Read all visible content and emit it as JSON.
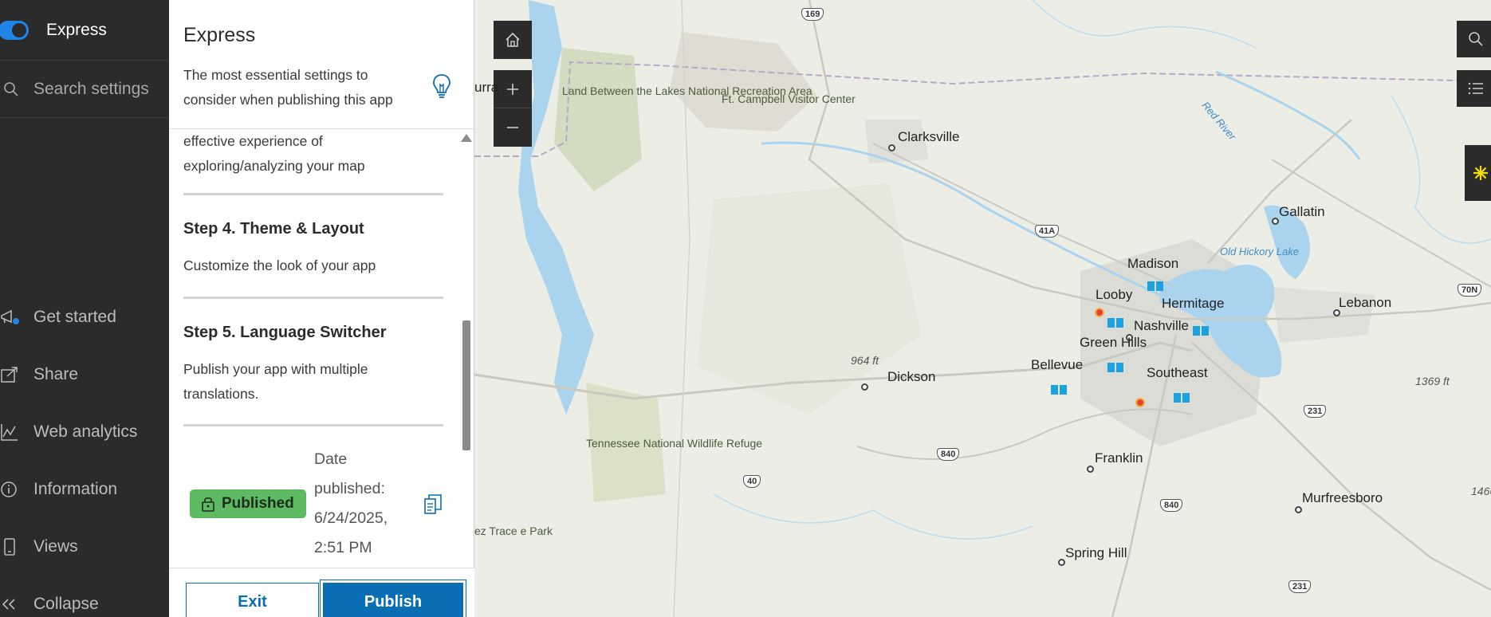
{
  "nav": {
    "mode_label": "Express",
    "search_placeholder": "Search settings",
    "items": [
      {
        "label": "Get started",
        "icon": "megaphone-icon"
      },
      {
        "label": "Share",
        "icon": "share-icon"
      },
      {
        "label": "Web analytics",
        "icon": "analytics-icon"
      },
      {
        "label": "Information",
        "icon": "information-icon"
      },
      {
        "label": "Views",
        "icon": "mobile-device-icon"
      },
      {
        "label": "Collapse",
        "icon": "double-chevron-left-icon"
      }
    ],
    "toggle_color": "#1f86e8"
  },
  "panel": {
    "title": "Express",
    "description": "The most essential settings to consider when publishing this app",
    "step3_tail": "effective experience of exploring/analyzing your map",
    "steps": [
      {
        "title": "Step 4. Theme & Layout",
        "desc": "Customize the look of your app"
      },
      {
        "title": "Step 5. Language Switcher",
        "desc": "Publish your app with multiple translations."
      }
    ],
    "status_badge": "Published",
    "date_published": "Date published: 6/24/2025, 2:51 PM",
    "exit_label": "Exit",
    "publish_label": "Publish"
  },
  "map": {
    "places": {
      "clarksville": "Clarksville",
      "gallatin": "Gallatin",
      "madison": "Madison",
      "looby": "Looby",
      "hermitage": "Hermitage",
      "nashville": "Nashville",
      "green_hills": "Green Hills",
      "bellevue": "Bellevue",
      "southeast": "Southeast",
      "lebanon": "Lebanon",
      "dickson": "Dickson",
      "franklin": "Franklin",
      "murfreesboro": "Murfreesboro",
      "spring_hill": "Spring Hill",
      "murray": "urra"
    },
    "parks": {
      "lbl": "Land Between the Lakes National Recreation Area",
      "campbell": "Ft. Campbell Visitor Center",
      "tennessee": "Tennessee National Wildlife Refuge",
      "natchez": "ez Trace e Park"
    },
    "water": {
      "old_hickory": "Old Hickory Lake",
      "red_river": "Red River"
    },
    "elevations": {
      "e964": "964 ft",
      "e1369": "1369 ft",
      "e1466": "1466"
    },
    "shields": {
      "s169": "169",
      "s41a": "41A",
      "s70n": "70N",
      "s840a": "840",
      "s840b": "840",
      "s40": "40",
      "s231a": "231",
      "s231b": "231"
    },
    "colors": {
      "water": "#aad3ee",
      "land": "#eceee6",
      "urban": "#dcdcd6",
      "park": "#cfd8b8",
      "library_marker": "#1aa3e0",
      "alert_marker": "#e0462a"
    }
  }
}
